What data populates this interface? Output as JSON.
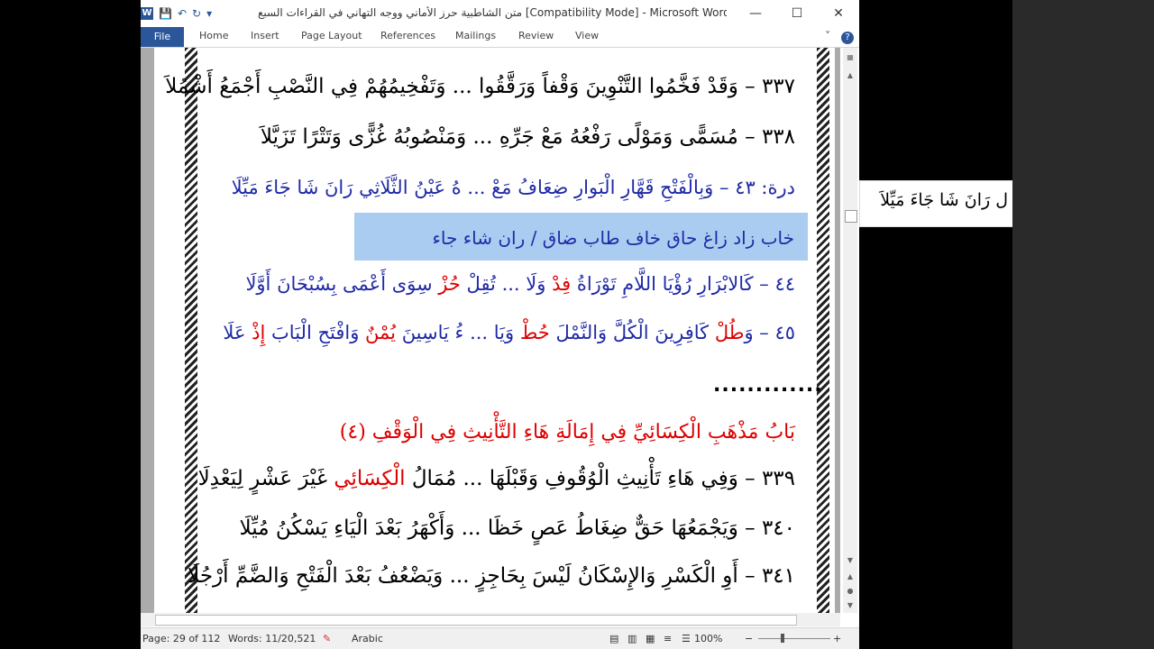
{
  "window": {
    "title": "متن الشاطبية حرز الأماني ووجه التهاني في القراءات السبع [Compatibility Mode] - Microsoft Word",
    "app_icon": "W",
    "controls": {
      "minimize": "—",
      "maximize": "☐",
      "close": "✕"
    }
  },
  "qat": {
    "save": "💾",
    "undo": "↶",
    "redo": "↻",
    "more": "▾"
  },
  "ribbon": {
    "file": "File",
    "tabs": [
      "Home",
      "Insert",
      "Page Layout",
      "References",
      "Mailings",
      "Review",
      "View"
    ],
    "collapse": "˅",
    "help": "?"
  },
  "document": {
    "v337": "٣٣٧ – وَقَدْ فَخَّمُوا التَّنْوِينَ وَقْفاً وَرَقَّقُوا ... وَتَفْخِيمُهُمْ فِي النَّصْبِ أَجْمَعُ أَشْمُلاَ",
    "v338": "٣٣٨ – مُسَمًّى وَمَوْلًى رَفْعُهُ مَعْ جَرِّهِ ... وَمَنْصُوبُهُ غُزًّى وَتَتْرًا تَزَيَّلاَ",
    "dura43_prefix": "درة: ٤٣ – ",
    "dura43_text": "وَبِالْفَتْحِ قَهَّارِ الْبَوارِ ضِعَافُ مَعْ ... هُ عَيْنُ الثَّلَاثِي رَانَ شَا جَاءَ مَيِّلَا",
    "highlight_text": "خاب زاد زاغ حاق خاف طاب ضاق / ران شاء جاء",
    "v44_a": "٤٤ – كَالابْرَارِ رُؤْيَا اللَّامِ تَوْرَاةُ ",
    "v44_b": "فِدْ",
    "v44_c": " وَلَا ... تُقِلْ ",
    "v44_d": "حُزْ",
    "v44_e": " سِوَى أَعْمَى بِسُبْحَانَ أَوَّلَا",
    "v45_a": "٤٥ – وَ",
    "v45_b": "طُلْ",
    "v45_c": " كَافِرِينَ الْكُلَّ وَالنَّمْلَ ",
    "v45_d": "حُطْ",
    "v45_e": " وَيَا ... ءُ يَاسِينَ ",
    "v45_f": "يُمْنٌ",
    "v45_g": " وَافْتَحِ الْبَابَ ",
    "v45_h": "إِذْ",
    "v45_i": " عَلَا",
    "dots": ".............",
    "heading": "بَابُ مَذْهَبِ الْكِسَائِيِّ فِي إِمَالَةِ هَاءِ التَّأْنِيثِ فِي الْوَقْفِ (٤)",
    "v339_a": "٣٣٩ – وَفِي هَاءِ تَأْنِيثِ الْوُقُوفِ وَقَبْلَهَا ... مُمَالُ ",
    "v339_b": "الْكِسَائِي",
    "v339_c": " غَيْرَ عَشْرٍ لِيَعْدِلَا",
    "v340": "٣٤٠ – وَيَجْمَعُهَا حَقٌّ ضِغَاطُ عَصٍ خَظَا ... وَأَكْهَرُ بَعْدَ الْيَاءِ يَسْكُنُ مُيِّلَا",
    "v341": "٣٤١ – أَوِ الْكَسْرِ وَالإِسْكَانُ لَيْسَ بِحَاجِزٍ ... وَيَضْعُفُ بَعْدَ الْفَتْحِ وَالضَّمِّ أَرْجُلَا"
  },
  "popup": {
    "text": "ل رَانَ شَا جَاءَ مَيِّلاَ"
  },
  "status": {
    "page": "Page: 29 of 112",
    "words": "Words: 11/20,521",
    "language": "Arabic",
    "zoom": "100%",
    "zoom_minus": "−",
    "zoom_plus": "+"
  }
}
